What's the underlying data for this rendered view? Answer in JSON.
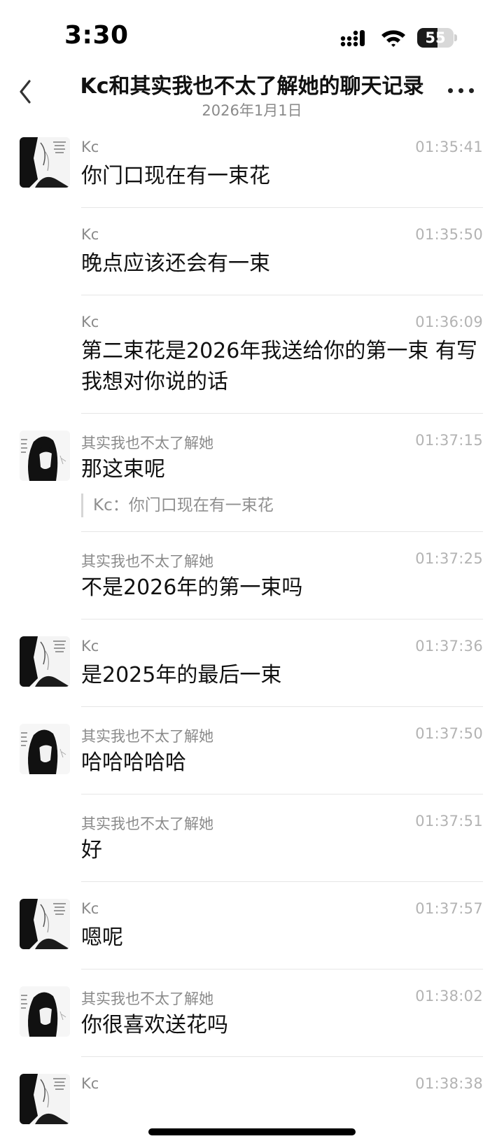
{
  "status_bar": {
    "time": "3:30",
    "battery": "55",
    "battery_level": 0.55
  },
  "header": {
    "title": "Kc和其实我也不太了解她的聊天记录",
    "subtitle": "2026年1月1日",
    "back_icon": "chevron-left-icon",
    "more_icon": "more-horizontal-icon"
  },
  "messages": [
    {
      "sender": "Kc",
      "time": "01:35:41",
      "text": "你门口现在有一束花",
      "avatar": "kc",
      "quote": ""
    },
    {
      "sender": "Kc",
      "time": "01:35:50",
      "text": "晚点应该还会有一束",
      "avatar": "",
      "quote": ""
    },
    {
      "sender": "Kc",
      "time": "01:36:09",
      "text": "第二束花是2026年我送给你的第一束  有写我想对你说的话",
      "avatar": "",
      "quote": ""
    },
    {
      "sender": "其实我也不太了解她",
      "time": "01:37:15",
      "text": "那这束呢",
      "avatar": "her",
      "quote": "Kc：你门口现在有一束花"
    },
    {
      "sender": "其实我也不太了解她",
      "time": "01:37:25",
      "text": "不是2026年的第一束吗",
      "avatar": "",
      "quote": ""
    },
    {
      "sender": "Kc",
      "time": "01:37:36",
      "text": "是2025年的最后一束",
      "avatar": "kc",
      "quote": ""
    },
    {
      "sender": "其实我也不太了解她",
      "time": "01:37:50",
      "text": "哈哈哈哈哈",
      "avatar": "her",
      "quote": ""
    },
    {
      "sender": "其实我也不太了解她",
      "time": "01:37:51",
      "text": "好",
      "avatar": "",
      "quote": ""
    },
    {
      "sender": "Kc",
      "time": "01:37:57",
      "text": "嗯呢",
      "avatar": "kc",
      "quote": ""
    },
    {
      "sender": "其实我也不太了解她",
      "time": "01:38:02",
      "text": "你很喜欢送花吗",
      "avatar": "her",
      "quote": ""
    },
    {
      "sender": "Kc",
      "time": "01:38:38",
      "text": "",
      "avatar": "kc",
      "quote": ""
    }
  ]
}
